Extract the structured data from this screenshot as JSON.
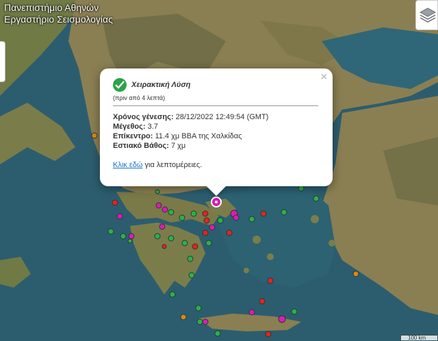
{
  "header": {
    "line1": "Πανεπιστήμιο Αθηνών",
    "line2": "Εργαστήριο Σεισμολογίας"
  },
  "popup": {
    "close": "×",
    "title": "Χειρακτική Λύση",
    "ago": "(πριν από 4 λεπτά)",
    "origin_label": "Χρόνος γένεσης:",
    "origin_value": " 28/12/2022 12:49:54 (GMT)",
    "mag_label": "Μέγεθος:",
    "mag_value": " 3.7",
    "epi_label": "Επίκεντρο:",
    "epi_value": " 11.4 χμ ΒΒΑ της Χαλκίδας",
    "depth_label": "Εστιακό Βάθος:",
    "depth_value": " 7 χμ",
    "link": "Κλικ εδώ",
    "link_rest": " για λεπτομέρειες."
  },
  "scale": {
    "label": "100 km"
  },
  "colors": {
    "sea": "#2c5d6e",
    "land": "#8a7f52",
    "mountain": "#6b6a45",
    "green_event": "#25b34a",
    "red_event": "#e0261e",
    "magenta_event": "#d91cb8",
    "orange_event": "#d68a18",
    "check": "#2ca24a"
  },
  "icons": [
    "layers-icon",
    "check-icon",
    "close-icon"
  ]
}
